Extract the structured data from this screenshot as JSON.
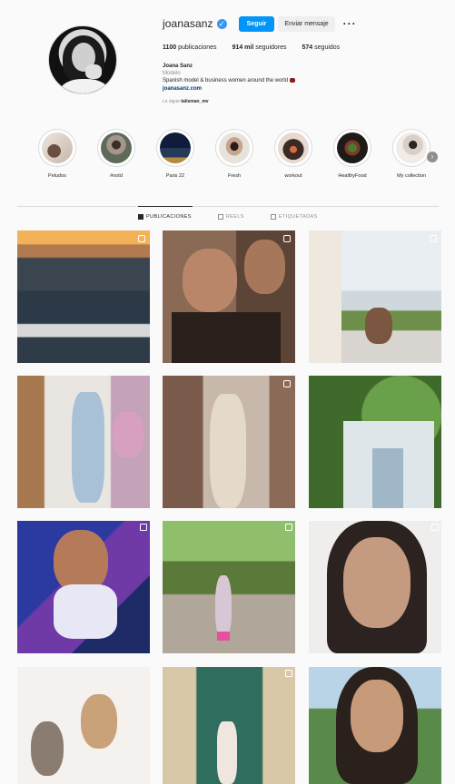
{
  "profile": {
    "username": "joanasanz",
    "verified_icon": "verified-badge-icon",
    "follow_label": "Seguir",
    "message_label": "Enviar mensaje",
    "more_label": "···",
    "posts_count": "1100",
    "posts_label": "publicaciones",
    "followers_count": "914 mil",
    "followers_label": "seguidores",
    "following_count": "574",
    "following_label": "seguidos",
    "name": "Joana Sanz",
    "category": "Modelo",
    "bio_line": "Spanish model & business women around the world",
    "link": "joanasanz.com",
    "followed_by_prefix": "Le sigue",
    "followed_by_user": "talisman_mv"
  },
  "highlights": [
    {
      "label": "Peludos"
    },
    {
      "label": "#ootd"
    },
    {
      "label": "Paris 22"
    },
    {
      "label": "Fresh"
    },
    {
      "label": "workout"
    },
    {
      "label": "HealthyFood"
    },
    {
      "label": "My collection"
    }
  ],
  "tabs": [
    {
      "label": "PUBLICACIONES",
      "icon": "grid-icon"
    },
    {
      "label": "REELS",
      "icon": "reels-icon"
    },
    {
      "label": "ETIQUETADAS",
      "icon": "tagged-icon"
    }
  ],
  "colors": {
    "accent": "#0095f6",
    "link": "#00376b",
    "background": "#fafafa"
  }
}
